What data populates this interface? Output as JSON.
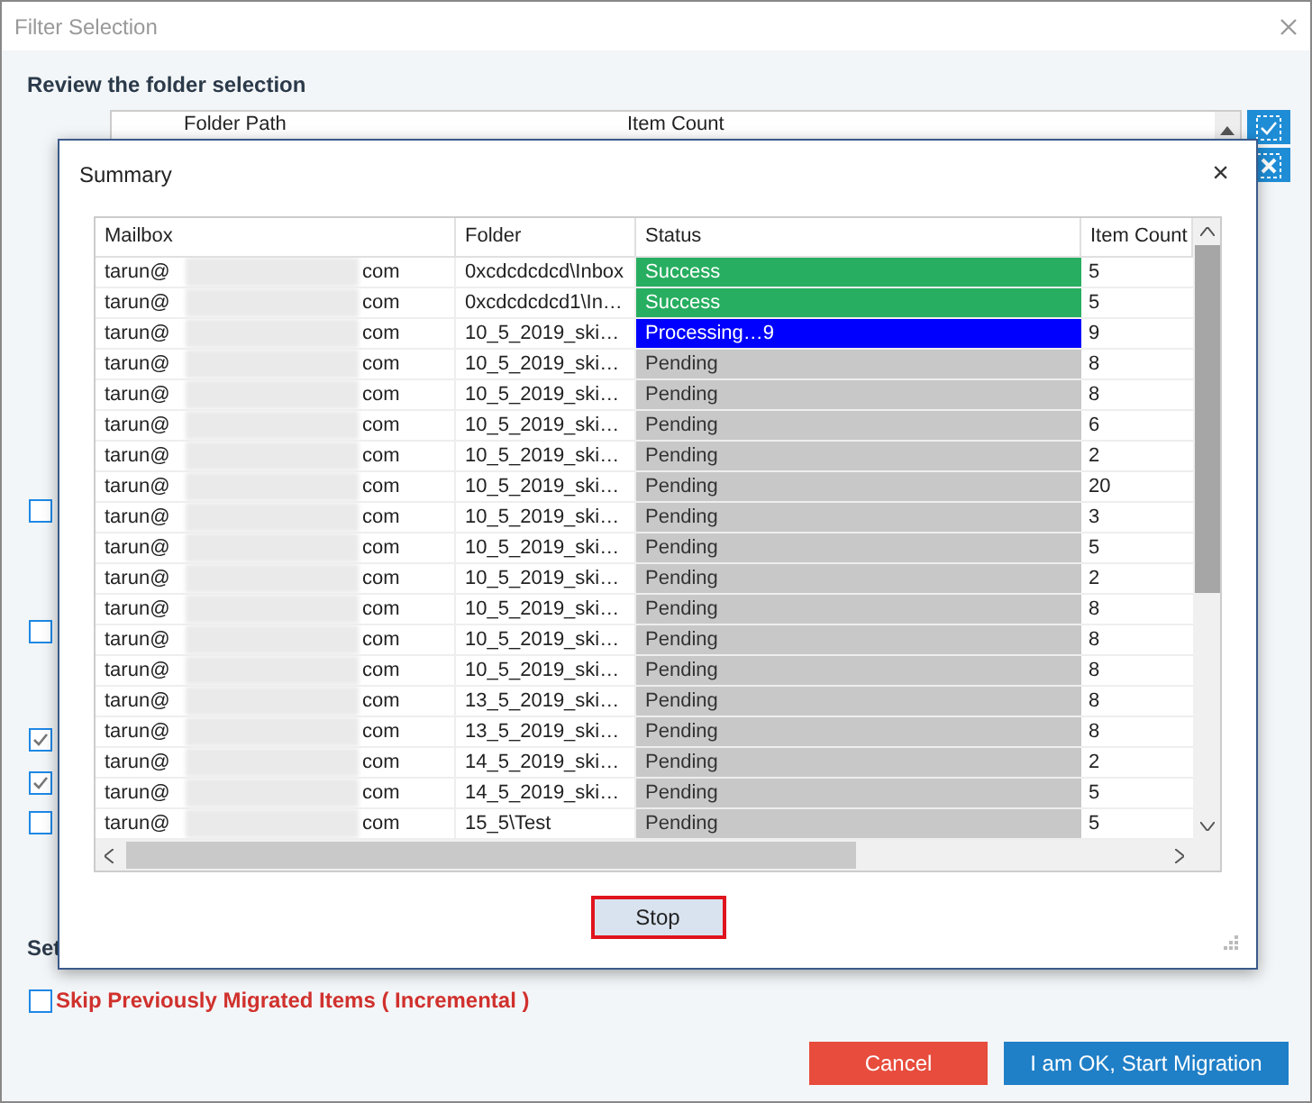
{
  "window": {
    "title": "Filter Selection"
  },
  "section_title": "Review the folder selection",
  "folder_table": {
    "columns": [
      "Folder Path",
      "Item Count"
    ]
  },
  "side_buttons": [
    {
      "kind": "check"
    },
    {
      "kind": "clear"
    }
  ],
  "options": [
    {
      "checked": false
    },
    {
      "checked": false
    },
    {
      "checked": true
    },
    {
      "checked": true
    },
    {
      "checked": false
    }
  ],
  "settings_title": "Set",
  "incremental": {
    "label": "Skip Previously Migrated Items ( Incremental )",
    "checked": false
  },
  "buttons": [
    {
      "label": "Cancel",
      "kind": "cancel"
    },
    {
      "label": "I am OK, Start Migration",
      "kind": "primary"
    }
  ],
  "summary": {
    "title": "Summary",
    "close": "×",
    "columns": [
      "Mailbox",
      "Folder",
      "Status",
      "Item Count"
    ],
    "rows": [
      {
        "mailbox_start": "tarun@",
        "mailbox_end": "com",
        "folder": "0xcdcdcdcd\\Inbox",
        "status": "Success",
        "kind": "success",
        "count": "5"
      },
      {
        "mailbox_start": "tarun@",
        "mailbox_end": "com",
        "folder": "0xcdcdcdcd1\\In…",
        "status": "Success",
        "kind": "success",
        "count": "5"
      },
      {
        "mailbox_start": "tarun@",
        "mailbox_end": "com",
        "folder": "10_5_2019_ski…",
        "status": "Processing…9",
        "kind": "processing",
        "count": "9"
      },
      {
        "mailbox_start": "tarun@",
        "mailbox_end": "com",
        "folder": "10_5_2019_ski…",
        "status": "Pending",
        "kind": "pending",
        "count": "8"
      },
      {
        "mailbox_start": "tarun@",
        "mailbox_end": "com",
        "folder": "10_5_2019_ski…",
        "status": "Pending",
        "kind": "pending",
        "count": "8"
      },
      {
        "mailbox_start": "tarun@",
        "mailbox_end": "com",
        "folder": "10_5_2019_ski…",
        "status": "Pending",
        "kind": "pending",
        "count": "6"
      },
      {
        "mailbox_start": "tarun@",
        "mailbox_end": "com",
        "folder": "10_5_2019_ski…",
        "status": "Pending",
        "kind": "pending",
        "count": "2"
      },
      {
        "mailbox_start": "tarun@",
        "mailbox_end": "com",
        "folder": "10_5_2019_ski…",
        "status": "Pending",
        "kind": "pending",
        "count": "20"
      },
      {
        "mailbox_start": "tarun@",
        "mailbox_end": "com",
        "folder": "10_5_2019_ski…",
        "status": "Pending",
        "kind": "pending",
        "count": "3"
      },
      {
        "mailbox_start": "tarun@",
        "mailbox_end": "com",
        "folder": "10_5_2019_ski…",
        "status": "Pending",
        "kind": "pending",
        "count": "5"
      },
      {
        "mailbox_start": "tarun@",
        "mailbox_end": "com",
        "folder": "10_5_2019_ski…",
        "status": "Pending",
        "kind": "pending",
        "count": "2"
      },
      {
        "mailbox_start": "tarun@",
        "mailbox_end": "com",
        "folder": "10_5_2019_ski…",
        "status": "Pending",
        "kind": "pending",
        "count": "8"
      },
      {
        "mailbox_start": "tarun@",
        "mailbox_end": "com",
        "folder": "10_5_2019_ski…",
        "status": "Pending",
        "kind": "pending",
        "count": "8"
      },
      {
        "mailbox_start": "tarun@",
        "mailbox_end": "com",
        "folder": "10_5_2019_ski…",
        "status": "Pending",
        "kind": "pending",
        "count": "8"
      },
      {
        "mailbox_start": "tarun@",
        "mailbox_end": "com",
        "folder": "13_5_2019_ski…",
        "status": "Pending",
        "kind": "pending",
        "count": "8"
      },
      {
        "mailbox_start": "tarun@",
        "mailbox_end": "com",
        "folder": "13_5_2019_ski…",
        "status": "Pending",
        "kind": "pending",
        "count": "8"
      },
      {
        "mailbox_start": "tarun@",
        "mailbox_end": "com",
        "folder": "14_5_2019_ski…",
        "status": "Pending",
        "kind": "pending",
        "count": "2"
      },
      {
        "mailbox_start": "tarun@",
        "mailbox_end": "com",
        "folder": "14_5_2019_ski…",
        "status": "Pending",
        "kind": "pending",
        "count": "5"
      },
      {
        "mailbox_start": "tarun@",
        "mailbox_end": "com",
        "folder": "15_5\\Test",
        "status": "Pending",
        "kind": "pending",
        "count": "5"
      }
    ],
    "stop_button": "Stop"
  }
}
